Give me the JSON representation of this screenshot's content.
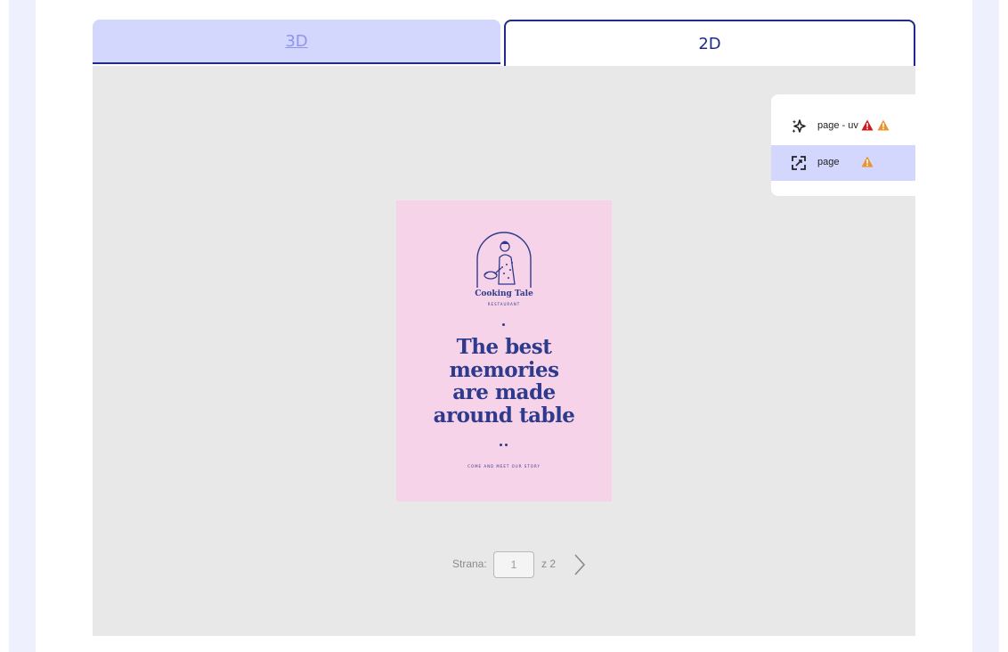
{
  "tabs": [
    {
      "label": "3D",
      "active": false
    },
    {
      "label": "2D",
      "active": true
    }
  ],
  "layers": [
    {
      "name": "page - uv",
      "icon": "sparkle-icon",
      "warnings": [
        "error",
        "warning"
      ],
      "selected": false
    },
    {
      "name": "page",
      "icon": "expand-icon",
      "warnings": [
        "warning"
      ],
      "selected": true
    }
  ],
  "artwork": {
    "brand": "Cooking Tale",
    "brand_sub": "RESTAURANT",
    "headline": [
      "The best",
      "memories",
      "are made",
      "around table"
    ],
    "tagline": "COME AND MEET OUR STORY"
  },
  "pager": {
    "label": "Strana:",
    "current": "1",
    "of": "z 2"
  },
  "colors": {
    "accent": "#1f2b8c",
    "tab_inactive_bg": "#d3d7fd",
    "canvas_bg": "#e8e8e8",
    "poster_bg": "#f6d3e8",
    "poster_ink": "#2e3a8c",
    "error": "#d0191b",
    "warning": "#e8942f"
  }
}
